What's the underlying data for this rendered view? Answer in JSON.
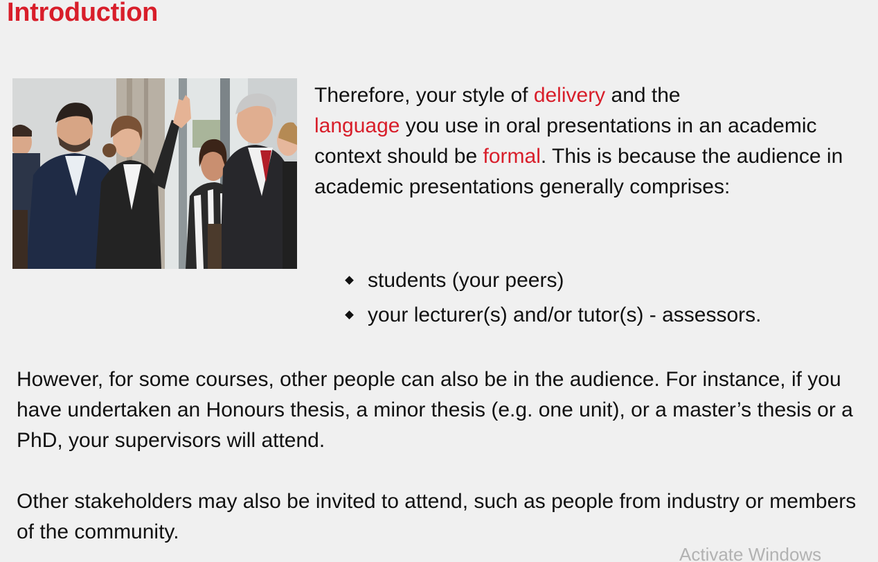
{
  "title": "Introduction",
  "photo": {
    "subject": "audience-photo"
  },
  "intro": {
    "part1": "Therefore, your style of ",
    "delivery": "delivery",
    "part2": " and the ",
    "language": "language",
    "part3": " you use in oral presentations in an academic context should be ",
    "formal": "formal",
    "part4": ". This is because the audience in academic presentations generally comprises:"
  },
  "bullets": [
    "students (your peers)",
    "your lecturer(s) and/or tutor(s) - assessors."
  ],
  "paragraph2": "However, for some courses, other people can also be in the audience. For instance, if you have undertaken an Honours thesis, a minor thesis (e.g. one unit), or a master’s thesis or a PhD, your supervisors will attend.",
  "paragraph3": "Other stakeholders may also be invited to attend, such as people from industry or members of the community.",
  "watermark": "Activate Windows",
  "colors": {
    "accent": "#d81e2a",
    "background": "#f0f0f0",
    "text": "#111111",
    "watermark": "#b2b2b2"
  }
}
